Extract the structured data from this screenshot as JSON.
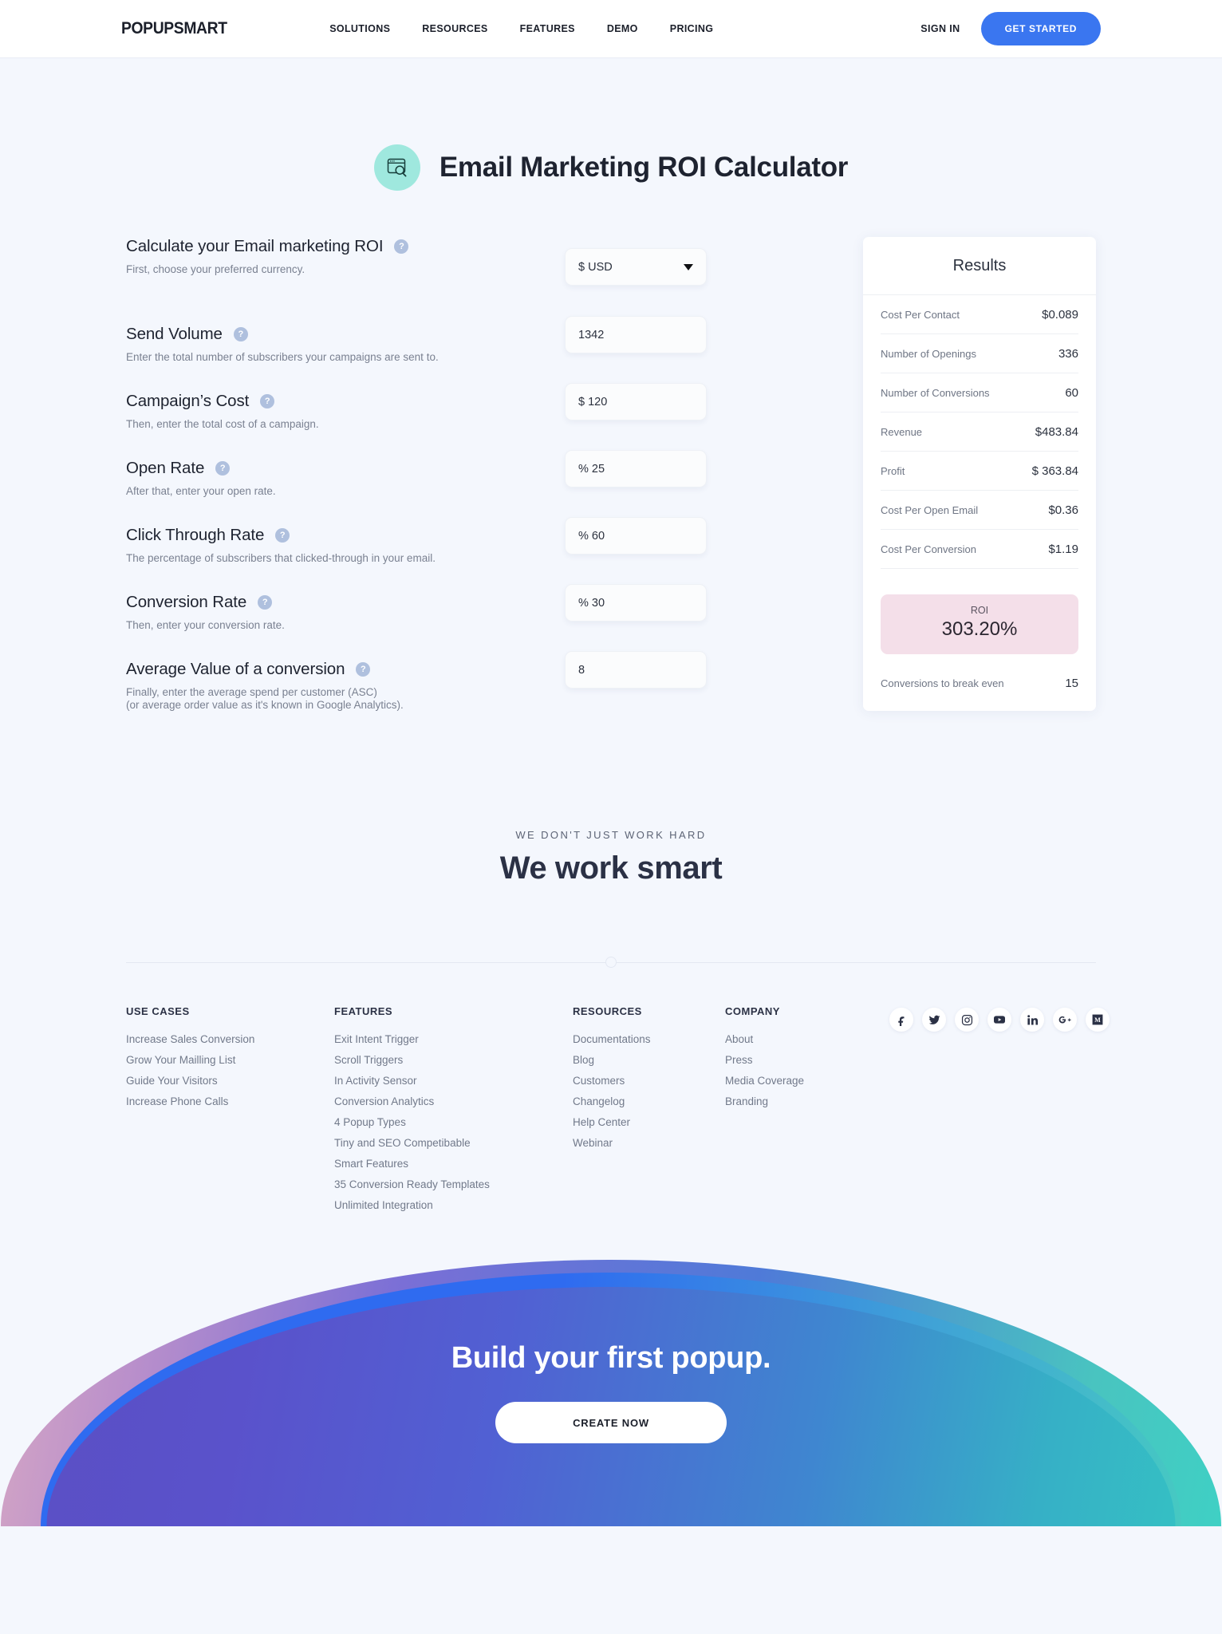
{
  "header": {
    "logo": "POPUPSMART",
    "nav": [
      {
        "label": "SOLUTIONS"
      },
      {
        "label": "RESOURCES"
      },
      {
        "label": "FEATURES"
      },
      {
        "label": "DEMO"
      },
      {
        "label": "PRICING"
      }
    ],
    "sign_in": "SIGN IN",
    "get_started": "GET STARTED",
    "accent_color": "#3a76f0"
  },
  "page": {
    "title": "Email Marketing ROI Calculator",
    "icon": "browser-search-icon",
    "icon_bg": "#9fe8de"
  },
  "calculator": {
    "fields": [
      {
        "label": "Calculate your Email marketing ROI",
        "desc": "First, choose your preferred currency.",
        "value": "$ USD",
        "type": "select",
        "help": "?"
      },
      {
        "label": "Send Volume",
        "desc": "Enter the total number of subscribers your campaigns are sent to.",
        "value": "1342",
        "type": "text",
        "help": "?"
      },
      {
        "label": "Campaign’s Cost",
        "desc": "Then, enter the total cost of a campaign.",
        "value": "$ 120",
        "type": "text",
        "help": "?"
      },
      {
        "label": "Open Rate",
        "desc": "After that, enter your open rate.",
        "value": "% 25",
        "type": "text",
        "help": "?"
      },
      {
        "label": "Click Through Rate",
        "desc": "The percentage of subscribers that clicked-through in your email.",
        "value": "% 60",
        "type": "text",
        "help": "?"
      },
      {
        "label": "Conversion Rate",
        "desc": "Then, enter your conversion rate.",
        "value": "% 30",
        "type": "text",
        "help": "?"
      },
      {
        "label": "Average Value of a conversion",
        "desc": "Finally, enter the average spend per customer (ASC)\n(or average order value as it's known in Google Analytics).",
        "value": "8",
        "type": "text",
        "help": "?"
      }
    ]
  },
  "results": {
    "title": "Results",
    "rows": [
      {
        "label": "Cost Per Contact",
        "value": "$0.089"
      },
      {
        "label": "Number of Openings",
        "value": "336"
      },
      {
        "label": "Number of Conversions",
        "value": "60"
      },
      {
        "label": "Revenue",
        "value": "$483.84"
      },
      {
        "label": "Profit",
        "value": "$ 363.84"
      },
      {
        "label": "Cost Per Open Email",
        "value": "$0.36"
      },
      {
        "label": "Cost Per Conversion",
        "value": "$1.19"
      }
    ],
    "roi": {
      "label": "ROI",
      "value": "303.20%",
      "bg_color": "#f4dfe9"
    },
    "breakeven": {
      "label": "Conversions to break even",
      "value": "15"
    }
  },
  "midsection": {
    "kicker": "WE DON'T JUST WORK HARD",
    "title": "We work smart"
  },
  "footer": {
    "columns": [
      {
        "heading": "USE CASES",
        "links": [
          "Increase Sales Conversion",
          "Grow Your Mailling List",
          "Guide Your Visitors",
          "Increase Phone Calls"
        ]
      },
      {
        "heading": "FEATURES",
        "links": [
          "Exit Intent Trigger",
          "Scroll Triggers",
          "In Activity Sensor",
          "Conversion Analytics",
          "4 Popup Types",
          "Tiny and SEO Competibable",
          "Smart Features",
          "35 Conversion Ready Templates",
          "Unlimited Integration"
        ]
      },
      {
        "heading": "RESOURCES",
        "links": [
          "Documentations",
          "Blog",
          "Customers",
          "Changelog",
          "Help Center",
          "Webinar"
        ]
      },
      {
        "heading": "COMPANY",
        "links": [
          "About",
          "Press",
          "Media Coverage",
          "Branding"
        ]
      }
    ],
    "socials": [
      {
        "name": "facebook-icon",
        "glyph": "f"
      },
      {
        "name": "twitter-icon",
        "glyph": "t"
      },
      {
        "name": "instagram-icon",
        "glyph": "i"
      },
      {
        "name": "youtube-icon",
        "glyph": "y"
      },
      {
        "name": "linkedin-icon",
        "glyph": "in"
      },
      {
        "name": "googleplus-icon",
        "glyph": "G+"
      },
      {
        "name": "medium-icon",
        "glyph": "M"
      }
    ]
  },
  "cta": {
    "title": "Build your first popup.",
    "button": "CREATE NOW"
  }
}
